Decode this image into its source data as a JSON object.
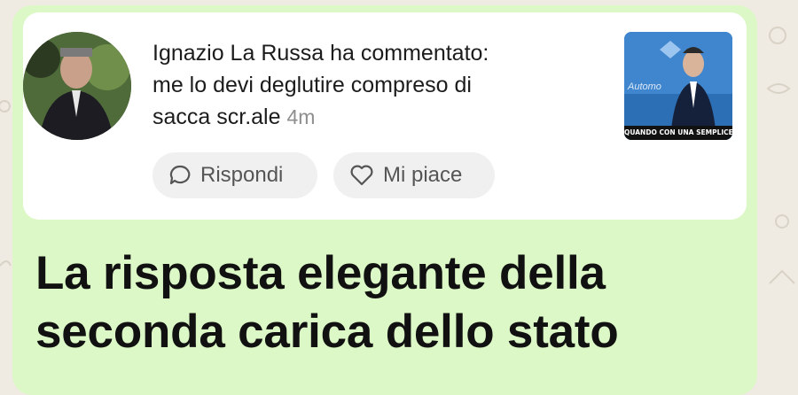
{
  "comment": {
    "author_line": "Ignazio La Russa ha commentato:",
    "text_line1": "me lo devi deglutire compreso di",
    "text_line2": "sacca scr.ale",
    "time": "4m"
  },
  "thumbnail": {
    "brand": "Automo",
    "caption": "QUANDO CON UNA SEMPLICE PATENTE"
  },
  "actions": {
    "reply_label": "Rispondi",
    "like_label": "Mi piace"
  },
  "headline": {
    "line1": "La risposta elegante della",
    "line2": "seconda carica dello stato"
  },
  "colors": {
    "bubble": "#dcf8c6",
    "card": "#ffffff",
    "pill": "#f0f0f0",
    "background": "#efeae2"
  },
  "icons": [
    "speech-bubble-icon",
    "heart-icon"
  ]
}
